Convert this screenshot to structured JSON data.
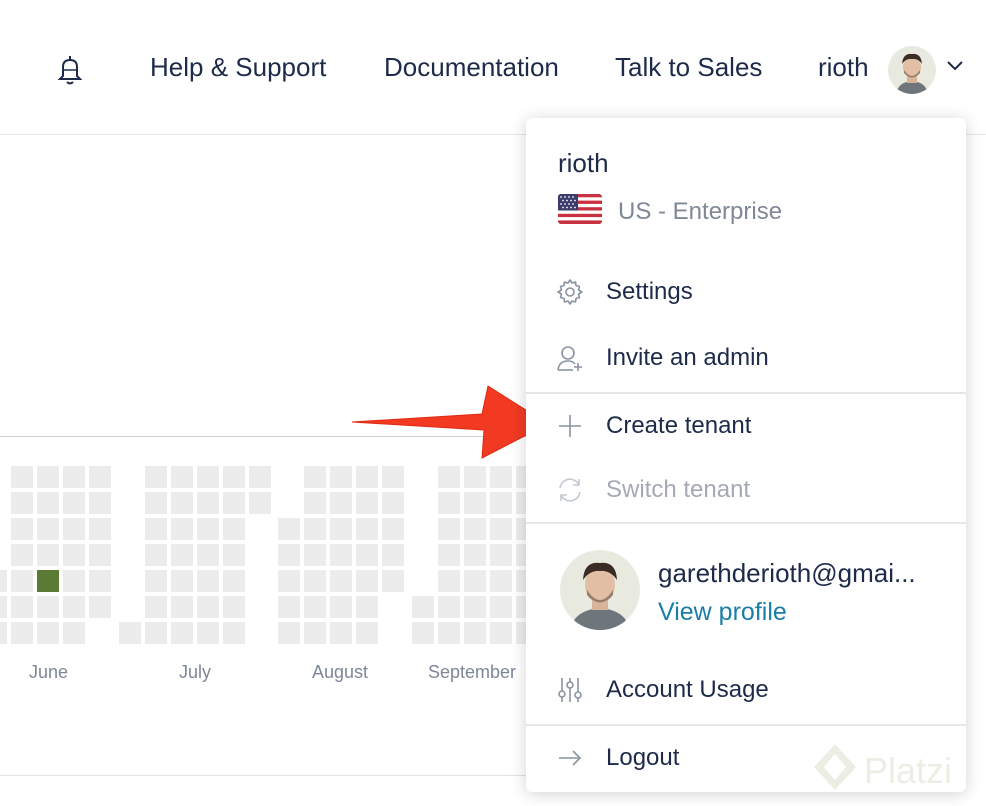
{
  "header": {
    "nav": [
      "Help & Support",
      "Documentation",
      "Talk to Sales"
    ],
    "username": "rioth"
  },
  "activity": {
    "months": [
      "June",
      "July",
      "August",
      "September"
    ],
    "highlight_color": "#5b7a34"
  },
  "dropdown": {
    "tenant_name": "rioth",
    "region": "US - Enterprise",
    "items": [
      {
        "label": "Settings",
        "icon": "gear-icon"
      },
      {
        "label": "Invite an admin",
        "icon": "add-user-icon"
      },
      {
        "label": "Create tenant",
        "icon": "plus-icon"
      },
      {
        "label": "Switch tenant",
        "icon": "switch-icon"
      },
      {
        "label": "Account Usage",
        "icon": "sliders-icon"
      },
      {
        "label": "Logout",
        "icon": "arrow-right-icon"
      }
    ],
    "email": "garethderioth@gmai...",
    "view_profile": "View profile"
  },
  "watermark": {
    "text": "Platzi"
  },
  "colors": {
    "annotation_arrow": "#f23a22",
    "link": "#1b7ea6"
  }
}
